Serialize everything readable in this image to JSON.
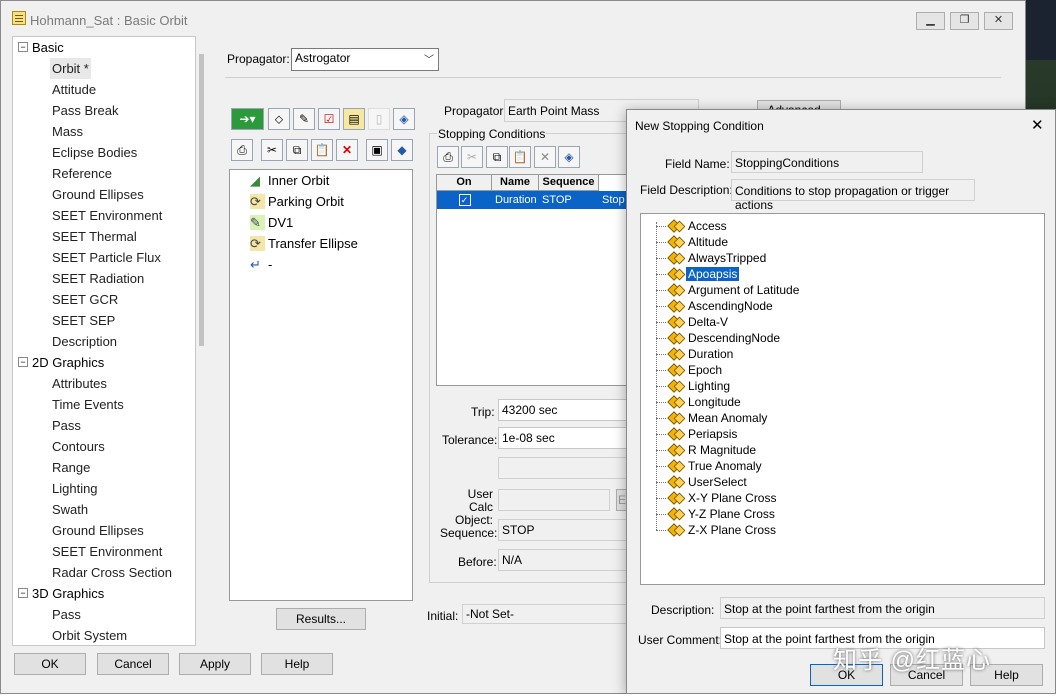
{
  "window": {
    "title": "Hohmann_Sat : Basic Orbit"
  },
  "tree": {
    "groups": [
      {
        "label": "Basic",
        "items": [
          "Orbit *",
          "Attitude",
          "Pass Break",
          "Mass",
          "Eclipse Bodies",
          "Reference",
          "Ground Ellipses",
          "SEET Environment",
          "SEET Thermal",
          "SEET Particle Flux",
          "SEET Radiation",
          "SEET GCR",
          "SEET SEP",
          "Description"
        ]
      },
      {
        "label": "2D Graphics",
        "items": [
          "Attributes",
          "Time Events",
          "Pass",
          "Contours",
          "Range",
          "Lighting",
          "Swath",
          "Ground Ellipses",
          "SEET Environment",
          "Radar Cross Section"
        ]
      },
      {
        "label": "3D Graphics",
        "items": [
          "Pass",
          "Orbit System"
        ]
      }
    ]
  },
  "propagator": {
    "label": "Propagator:",
    "value": "Astrogator"
  },
  "sequence": {
    "items": [
      "Inner Orbit",
      "Parking Orbit",
      "DV1",
      "Transfer Ellipse",
      "-"
    ],
    "results_button": "Results..."
  },
  "segment": {
    "propagator_label": "Propagator:",
    "propagator_value": "Earth Point Mass",
    "advanced_button": "Advanced...",
    "stopping_group": "Stopping Conditions",
    "grid": {
      "headers": [
        "On",
        "Name",
        "Sequence"
      ],
      "row": {
        "name": "Duration",
        "sequence": "STOP",
        "extra": "Stop"
      }
    },
    "trip_label": "Trip:",
    "trip_value": "43200 sec",
    "tolerance_label": "Tolerance:",
    "tolerance_value": "1e-08 sec",
    "user_calc_label": "User Calc Object:",
    "sequence_label": "Sequence:",
    "sequence_value": "STOP",
    "before_label": "Before:",
    "before_value": "N/A",
    "initial_label": "Initial:",
    "initial_value": "-Not Set-"
  },
  "bottom_buttons": {
    "ok": "OK",
    "cancel": "Cancel",
    "apply": "Apply",
    "help": "Help"
  },
  "dialog": {
    "title": "New Stopping Condition",
    "field_name_label": "Field Name:",
    "field_name_value": "StoppingConditions",
    "field_desc_label": "Field Description:",
    "field_desc_value": "Conditions to stop propagation or trigger actions",
    "conditions": [
      "Access",
      "Altitude",
      "AlwaysTripped",
      "Apoapsis",
      "Argument of Latitude",
      "AscendingNode",
      "Delta-V",
      "DescendingNode",
      "Duration",
      "Epoch",
      "Lighting",
      "Longitude",
      "Mean Anomaly",
      "Periapsis",
      "R Magnitude",
      "True Anomaly",
      "UserSelect",
      "X-Y Plane Cross",
      "Y-Z Plane Cross",
      "Z-X Plane Cross"
    ],
    "selected": "Apoapsis",
    "description_label": "Description:",
    "description_value": "Stop at the point farthest from the origin",
    "comment_label": "User Comment:",
    "comment_value": "Stop at the point farthest from the origin",
    "ok": "OK",
    "cancel": "Cancel",
    "help": "Help"
  },
  "watermark": "知乎 @红蓝心",
  "colors": {
    "selection": "#0a64c8",
    "background": "#f0f0f0"
  }
}
